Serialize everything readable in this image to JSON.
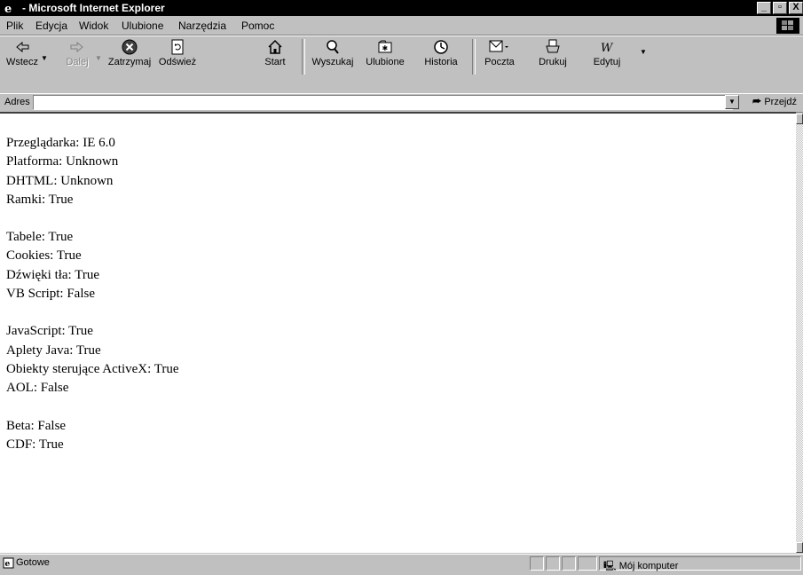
{
  "window": {
    "title": " - Microsoft Internet Explorer",
    "controls": [
      "_",
      "▫",
      "X"
    ]
  },
  "menu": {
    "items": [
      {
        "label": "Plik"
      },
      {
        "label": "Edycja"
      },
      {
        "label": "Widok"
      },
      {
        "label": "Ulubione"
      },
      {
        "label": "Narzędzia"
      },
      {
        "label": "Pomoc"
      }
    ]
  },
  "toolbar": {
    "buttons": [
      {
        "label": "Wstecz",
        "icon": "back-arrow-icon"
      },
      {
        "label": "Dalej",
        "icon": "forward-arrow-icon"
      },
      {
        "label": "Zatrzymaj",
        "icon": "stop-icon"
      },
      {
        "label": "Odśwież",
        "icon": "refresh-icon"
      },
      {
        "label": "Start",
        "icon": "home-icon"
      },
      {
        "label": "Wyszukaj",
        "icon": "search-icon"
      },
      {
        "label": "Ulubione",
        "icon": "favorites-icon"
      },
      {
        "label": "Historia",
        "icon": "history-icon"
      },
      {
        "label": "Poczta",
        "icon": "mail-icon"
      },
      {
        "label": "Drukuj",
        "icon": "print-icon"
      },
      {
        "label": "Edytuj",
        "icon": "edit-icon"
      }
    ]
  },
  "address": {
    "label": "Adres",
    "value": "",
    "go_label": "Przejdź"
  },
  "page": {
    "groups": [
      [
        "Przeglądarka: IE 6.0",
        "Platforma: Unknown",
        "DHTML: Unknown",
        "Ramki: True"
      ],
      [
        "Tabele: True",
        "Cookies: True",
        "Dźwięki tła: True",
        "VB Script: False"
      ],
      [
        "JavaScript: True",
        "Aplety Java: True",
        "Obiekty sterujące ActiveX: True",
        "AOL: False"
      ],
      [
        "Beta: False",
        "CDF: True"
      ]
    ]
  },
  "status": {
    "text": "Gotowe",
    "zone": "Mój komputer"
  }
}
